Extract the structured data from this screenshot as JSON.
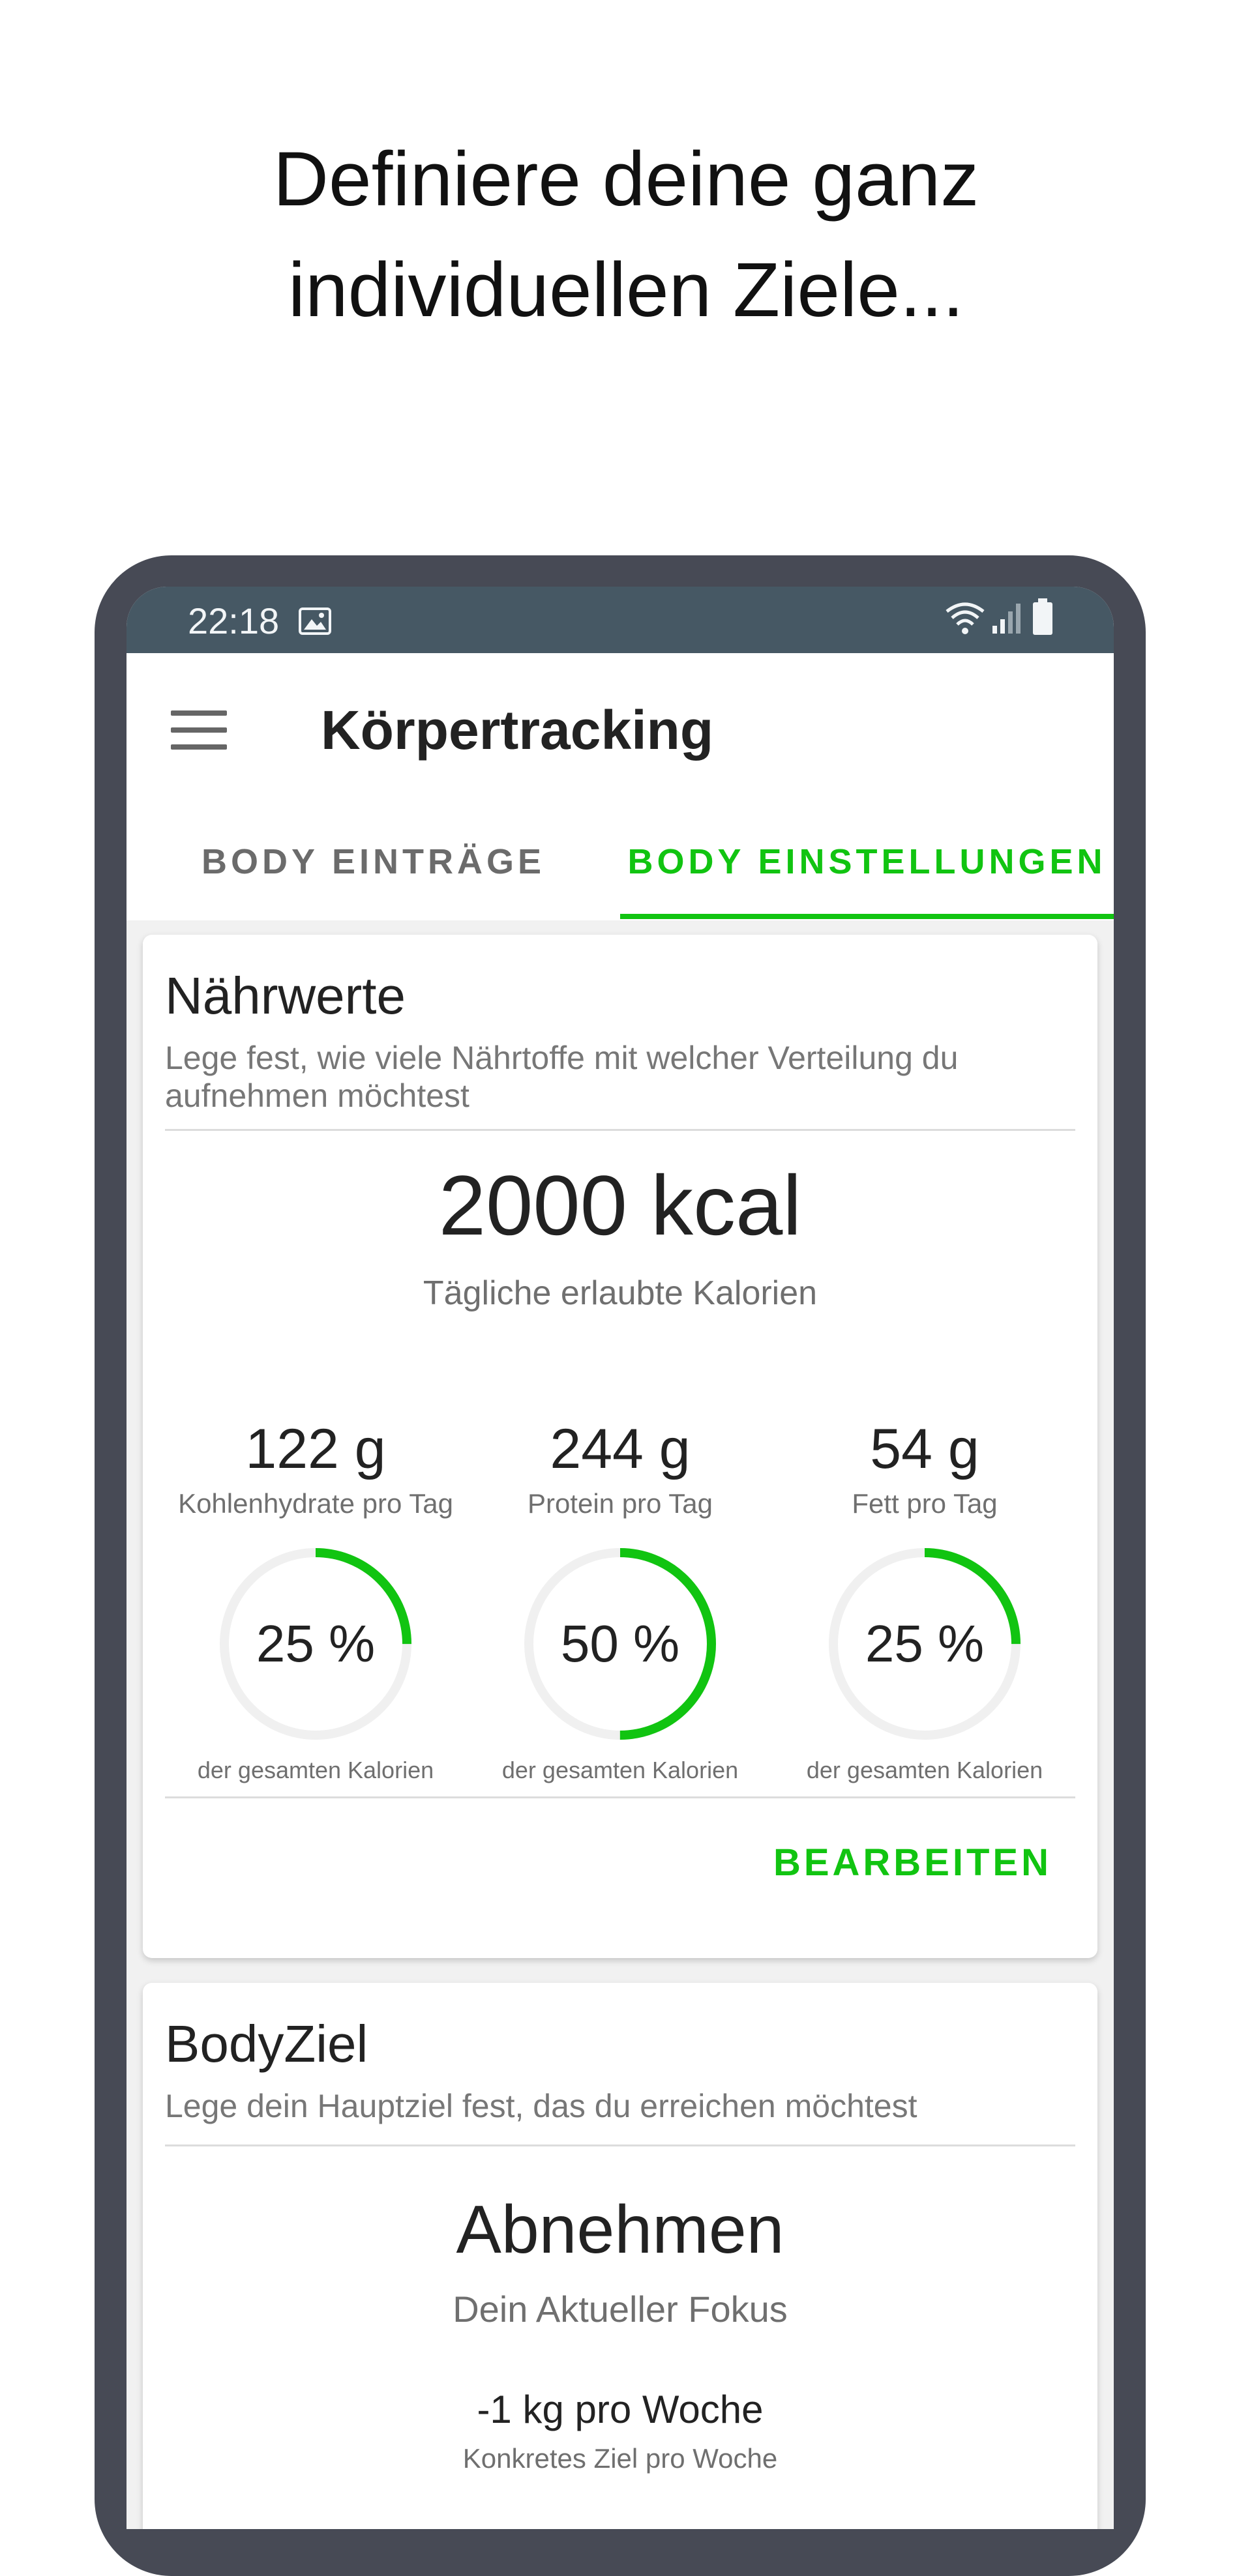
{
  "headline": {
    "line1": "Definiere deine ganz",
    "line2": "individuellen Ziele..."
  },
  "statusbar": {
    "time": "22:18",
    "icons": [
      "image-icon",
      "wifi-icon",
      "signal-icon",
      "battery-icon"
    ]
  },
  "appbar": {
    "title": "Körpertracking",
    "menu_icon": "menu-icon"
  },
  "tabs": [
    {
      "label": "BODY EINTRÄGE",
      "active": false
    },
    {
      "label": "BODY EINSTELLUNGEN",
      "active": true
    }
  ],
  "colors": {
    "accent": "#11c411",
    "statusbar": "#465864",
    "phone_frame": "#474a55",
    "ring_track": "#f0f0f0"
  },
  "nutrition_card": {
    "title": "Nährwerte",
    "description": "Lege fest, wie viele Nährtoffe mit welcher Verteilung du aufnehmen möchtest",
    "calories_value": "2000 kcal",
    "calories_label": "Tägliche erlaubte Kalorien",
    "macros": [
      {
        "grams": "122 g",
        "label": "Kohlenhydrate pro Tag",
        "percent_text": "25 %",
        "fraction": 0.25,
        "sub": "der gesamten Kalorien"
      },
      {
        "grams": "244 g",
        "label": "Protein pro Tag",
        "percent_text": "50 %",
        "fraction": 0.5,
        "sub": "der gesamten Kalorien"
      },
      {
        "grams": "54 g",
        "label": "Fett pro Tag",
        "percent_text": "25 %",
        "fraction": 0.25,
        "sub": "der gesamten Kalorien"
      }
    ],
    "edit_label": "BEARBEITEN"
  },
  "body_goal_card": {
    "title": "BodyZiel",
    "description": "Lege dein Hauptziel fest, das du erreichen möchtest",
    "goal_value": "Abnehmen",
    "goal_label": "Dein Aktueller Fokus",
    "weekly_value": "-1 kg pro Woche",
    "weekly_label": "Konkretes Ziel pro Woche"
  }
}
